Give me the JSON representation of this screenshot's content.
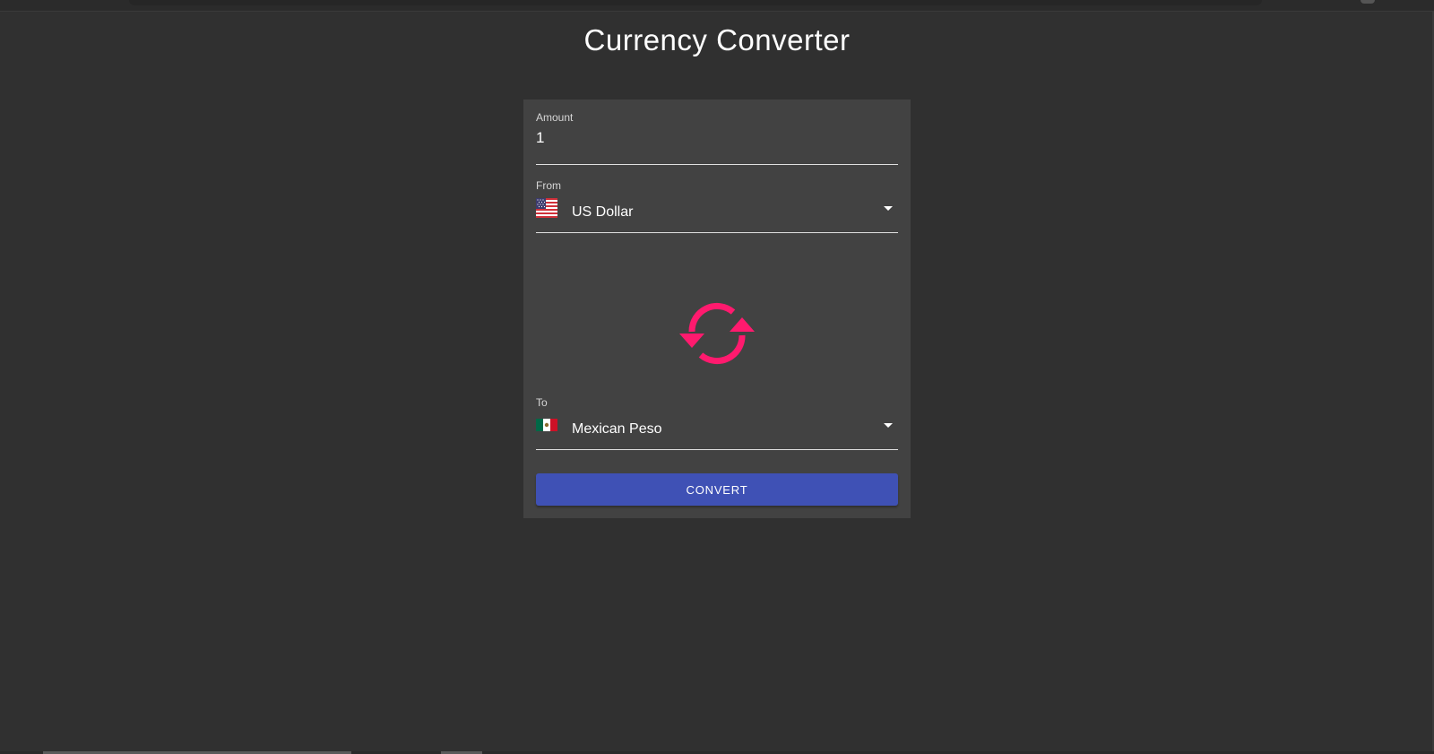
{
  "app": {
    "title": "Currency Converter"
  },
  "form": {
    "amount": {
      "label": "Amount",
      "value": "1"
    },
    "from": {
      "label": "From",
      "value": "US Dollar",
      "flag_icon": "us-flag-icon"
    },
    "to": {
      "label": "To",
      "value": "Mexican Peso",
      "flag_icon": "mexico-flag-icon"
    },
    "swap_icon": "swap-arrows-icon",
    "convert_label": "CONVERT"
  },
  "colors": {
    "background": "#303030",
    "card": "#424242",
    "accent": "#ff1a6e",
    "primary": "#3f51b5"
  }
}
